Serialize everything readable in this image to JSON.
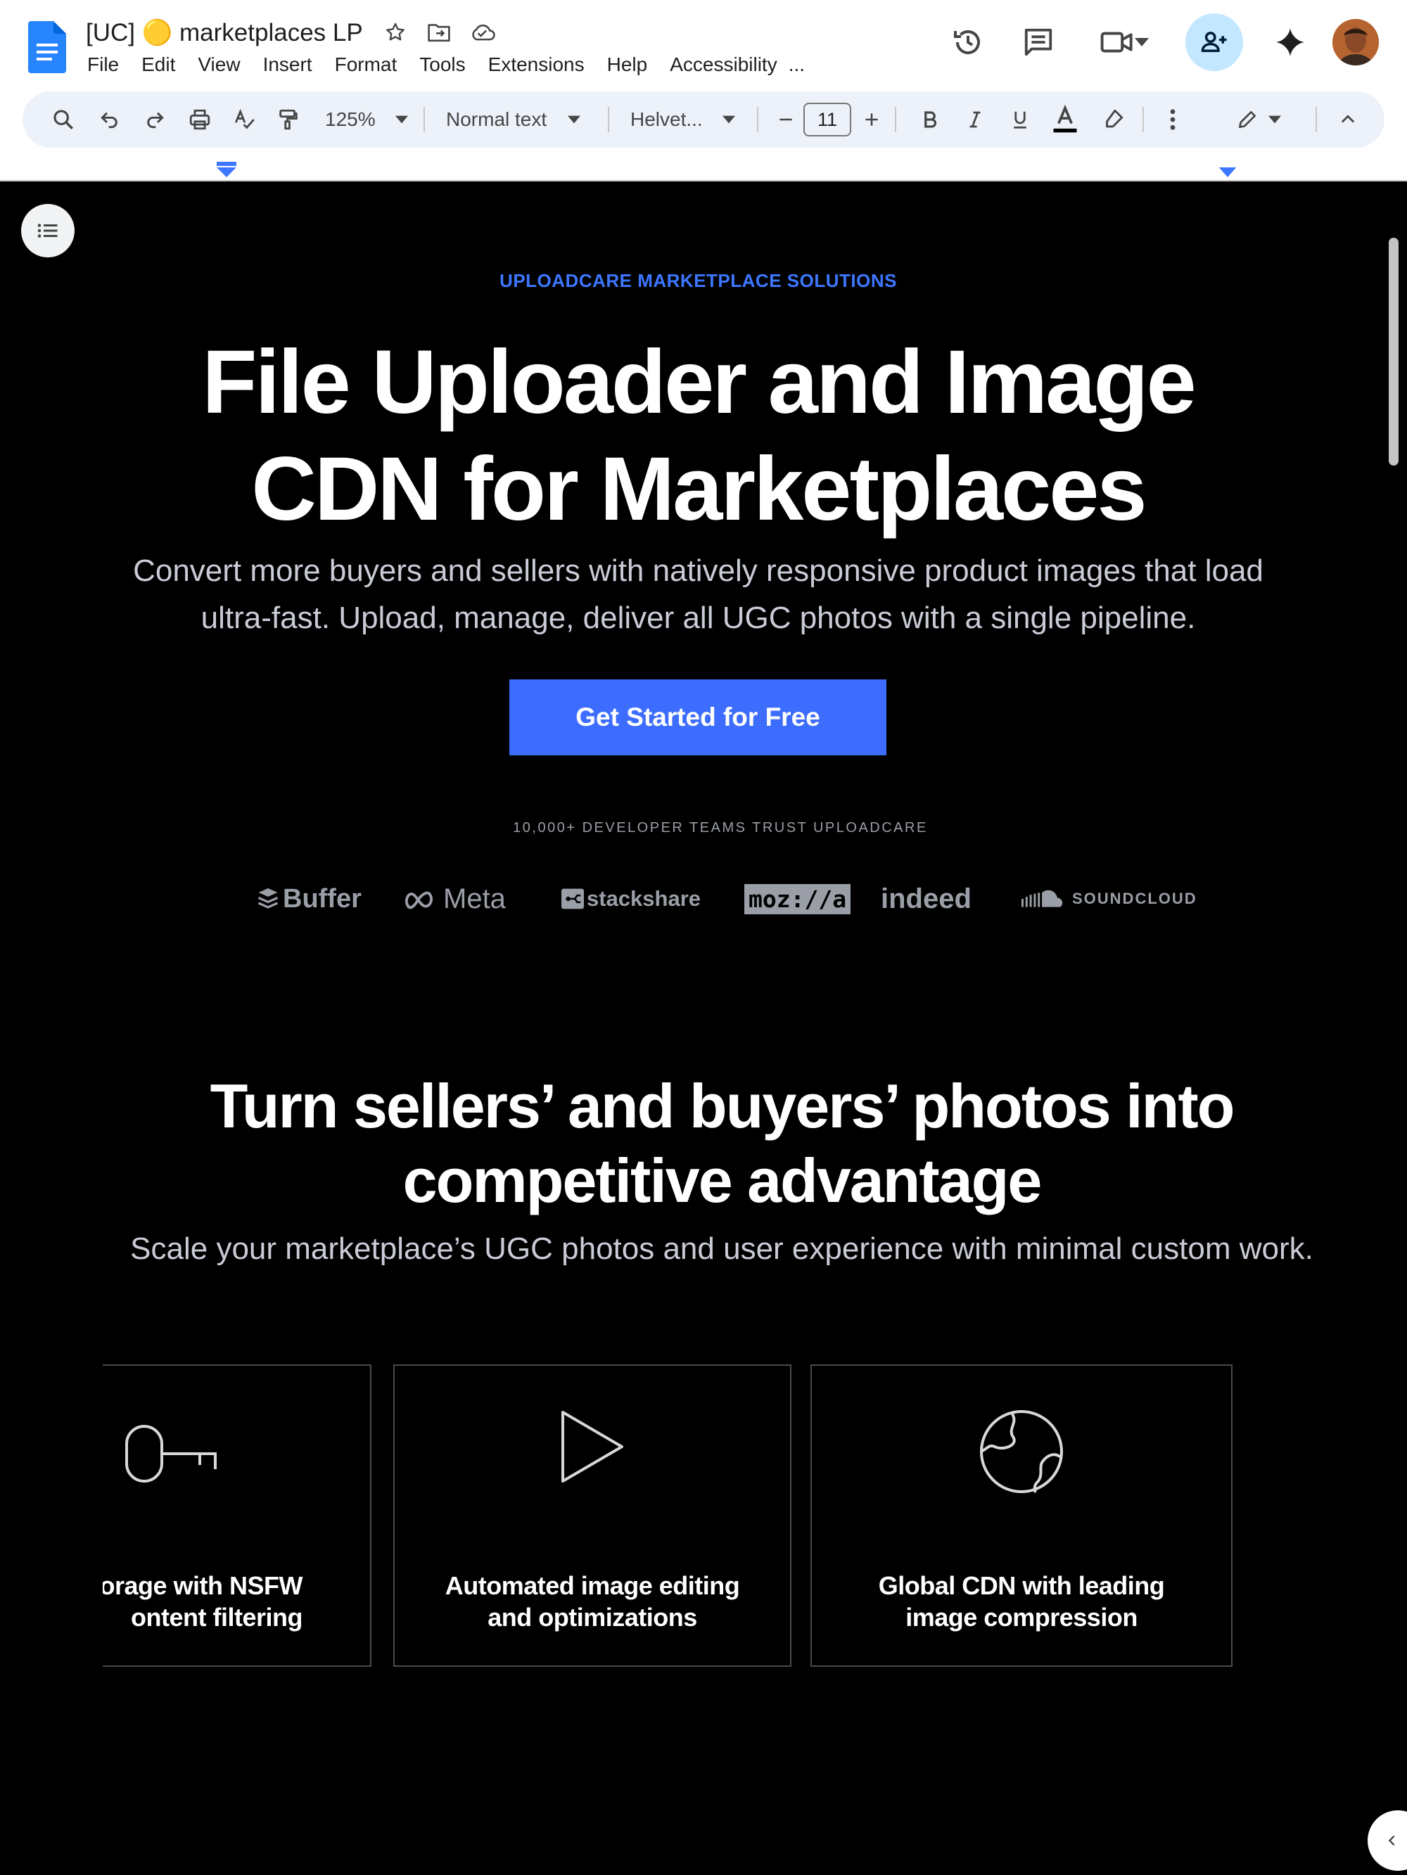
{
  "doc": {
    "title": "[UC] 🟡 marketplaces LP"
  },
  "menu": {
    "items": [
      "File",
      "Edit",
      "View",
      "Insert",
      "Format",
      "Tools",
      "Extensions",
      "Help",
      "Accessibility",
      "..."
    ]
  },
  "toolbar": {
    "zoom": "125%",
    "style": "Normal text",
    "font": "Helvet...",
    "font_size": "11"
  },
  "icons": {
    "star": "star-icon",
    "move": "move-to-folder-icon",
    "cloud": "cloud-saved-icon",
    "history": "version-history-icon",
    "comments": "comments-icon",
    "meet": "video-call-icon",
    "share": "add-person-icon",
    "gemini": "gemini-sparkle-icon"
  },
  "colors": {
    "accent_blue": "#3d77ff",
    "cta_blue": "#3d6dff",
    "canvas_bg": "#000000",
    "toolbar_bg": "#edf2fa",
    "share_bg": "#c2e7ff"
  },
  "hero": {
    "eyebrow": "UPLOADCARE MARKETPLACE SOLUTIONS",
    "title": "File Uploader and Image CDN for Marketplaces",
    "subtitle": "Convert more buyers and sellers with natively responsive product images that load ultra-fast. Upload, manage, deliver all UGC photos with a single pipeline.",
    "cta": "Get Started for Free",
    "trust": "10,000+ DEVELOPER TEAMS TRUST UPLOADCARE"
  },
  "logos": [
    "Buffer",
    "Meta",
    "stackshare",
    "moz://a",
    "indeed",
    "SOUNDCLOUD"
  ],
  "section": {
    "title": "Turn sellers’ and buyers’ photos into competitive advantage",
    "subtitle": "Scale your marketplace’s UGC photos and user experience with minimal custom work."
  },
  "cards": [
    {
      "icon": "key-icon",
      "line1": "storage with NSFW",
      "line2": "ontent filtering"
    },
    {
      "icon": "play-icon",
      "line1": "Automated image editing",
      "line2": "and optimizations"
    },
    {
      "icon": "globe-icon",
      "line1": "Global CDN with leading",
      "line2": "image compression"
    }
  ]
}
